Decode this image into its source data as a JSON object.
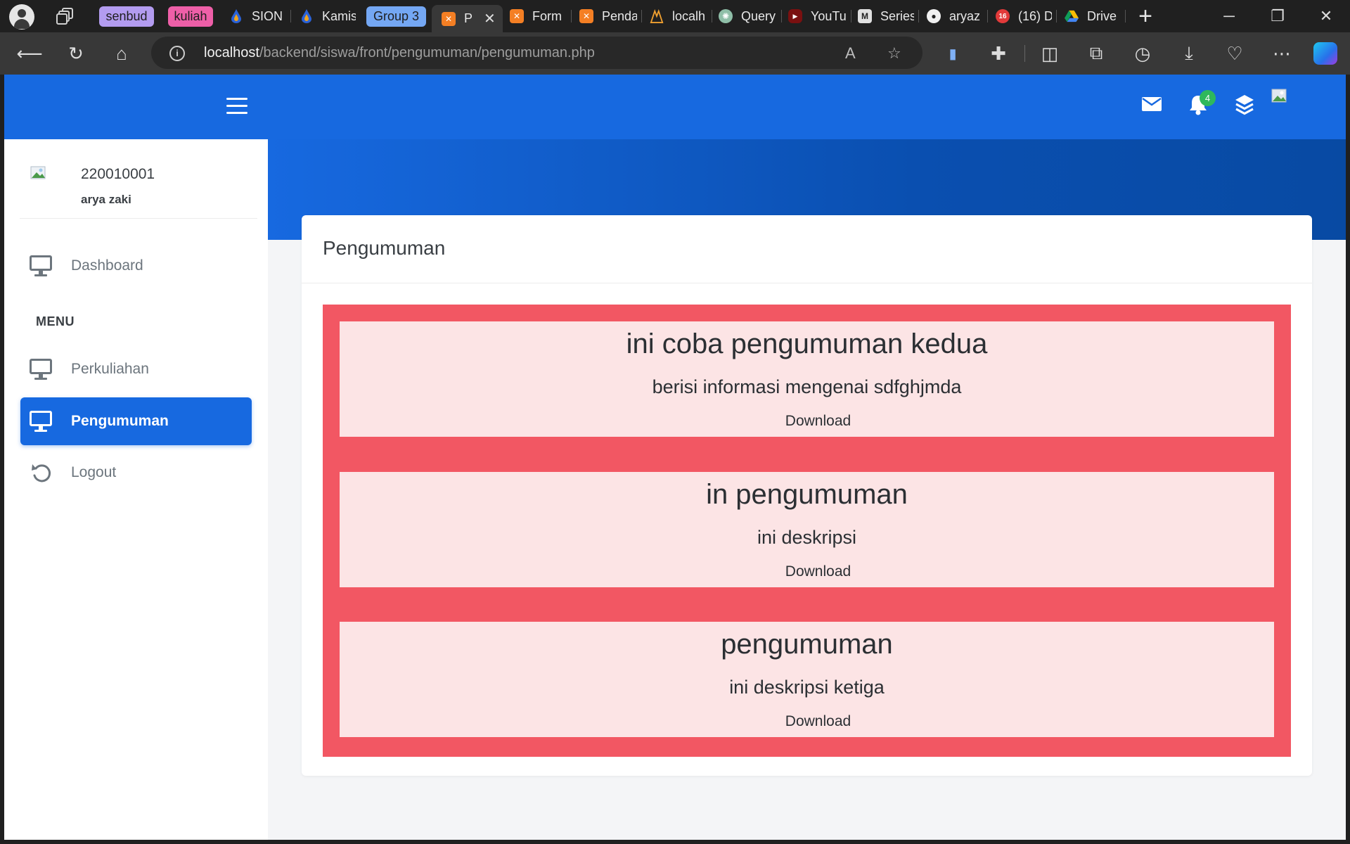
{
  "browser": {
    "group_pills": [
      {
        "label": "senbud",
        "color": "#b39cf0"
      },
      {
        "label": "kuliah",
        "color": "#ee5fa8"
      },
      {
        "label": "Group 3",
        "color": "#74a7f3"
      }
    ],
    "tabs": [
      {
        "label": "SION",
        "favicon": "drop-icon"
      },
      {
        "label": "Kamis",
        "favicon": "drop-icon"
      },
      {
        "label": "P",
        "favicon": "xampp-icon"
      },
      {
        "label": "Form",
        "favicon": "xampp-icon"
      },
      {
        "label": "Penda",
        "favicon": "xampp-icon"
      },
      {
        "label": "localh",
        "favicon": "phpmyadmin-icon"
      },
      {
        "label": "Query",
        "favicon": "chatgpt-icon"
      },
      {
        "label": "YouTu",
        "favicon": "youtube-icon"
      },
      {
        "label": "Series",
        "favicon": "medium-icon"
      },
      {
        "label": "aryaz",
        "favicon": "github-icon"
      },
      {
        "label": "(16) D",
        "favicon": "notification-icon"
      },
      {
        "label": "Drive",
        "favicon": "drive-icon"
      }
    ],
    "url_host": "localhost",
    "url_path": "/backend/siswa/front/pengumuman/pengumuman.php",
    "notification_tab_badge": "16"
  },
  "topbar": {
    "notification_count": "4",
    "icons": [
      "envelope-icon",
      "bell-icon",
      "layers-icon",
      "avatar-image"
    ]
  },
  "sidebar": {
    "user_id": "220010001",
    "user_name": "arya zaki",
    "dashboard": "Dashboard",
    "menu_heading": "MENU",
    "items": [
      {
        "label": "Perkuliahan"
      },
      {
        "label": "Pengumuman",
        "active": true
      },
      {
        "label": "Logout"
      }
    ]
  },
  "page": {
    "title": "Pengumuman",
    "announcements": [
      {
        "title": "ini coba pengumuman kedua",
        "description": "berisi informasi mengenai sdfghjmda",
        "link": "Download"
      },
      {
        "title": "in pengumuman",
        "description": "ini deskripsi",
        "link": "Download"
      },
      {
        "title": "pengumuman",
        "description": "ini deskripsi ketiga",
        "link": "Download"
      }
    ]
  },
  "colors": {
    "primary": "#1769e0",
    "announcement_frame": "#f25763",
    "announcement_bg": "#fce4e5",
    "badge_green": "#2eb85c"
  }
}
